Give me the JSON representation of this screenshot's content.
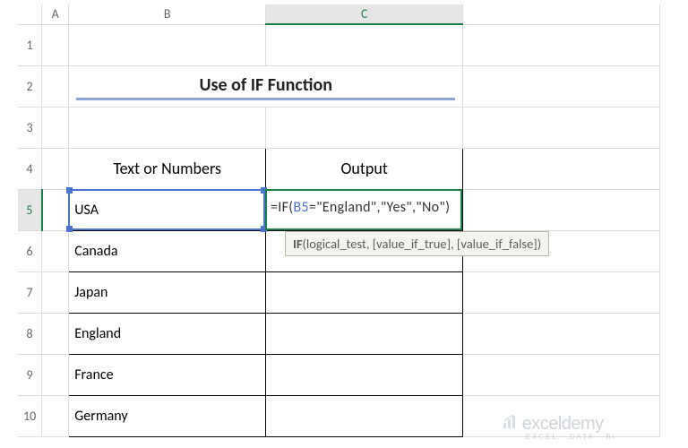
{
  "columns": {
    "rowhead": "",
    "A": "A",
    "B": "B",
    "C": "C"
  },
  "rows": [
    "1",
    "2",
    "3",
    "4",
    "5",
    "6",
    "7",
    "8",
    "9",
    "10"
  ],
  "title": "Use of IF Function",
  "headers": {
    "b": "Text or Numbers",
    "c": "Output"
  },
  "data": {
    "b5": "USA",
    "b6": "Canada",
    "b7": "Japan",
    "b8": "England",
    "b9": "France",
    "b10": "Germany"
  },
  "formula": {
    "prefix": "=IF(",
    "ref": "B5",
    "suffix": "=\"England\",\"Yes\",\"No\")"
  },
  "tooltip": {
    "fn": "IF",
    "sig": "(logical_test, [value_if_true], [value_if_false])"
  },
  "watermark": {
    "name": "exceldemy",
    "tag": "EXCEL · DATA · BI"
  },
  "active": {
    "col": "C",
    "row": "5"
  }
}
